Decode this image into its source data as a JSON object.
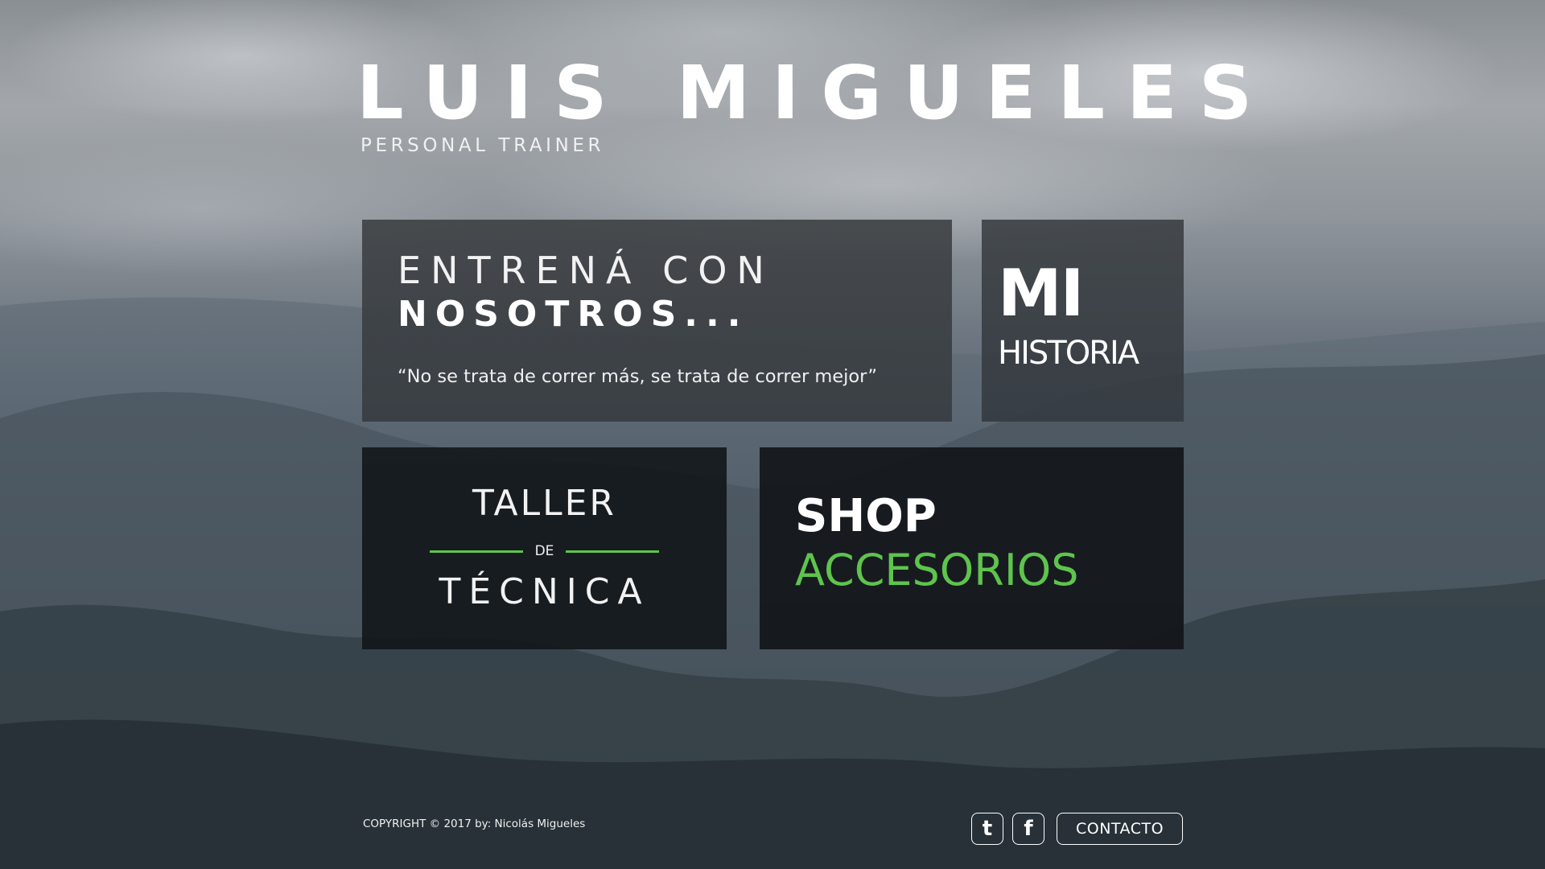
{
  "header": {
    "title": "LUIS MIGUELES",
    "subtitle": "PERSONAL TRAINER"
  },
  "tiles": {
    "entrena": {
      "line1": "ENTRENÁ CON",
      "line2": "NOSOTROS...",
      "quote": "“No se trata de correr más, se trata de correr mejor”"
    },
    "historia": {
      "line1": "MI",
      "line2": "HISTORIA"
    },
    "taller": {
      "line1": "TALLER",
      "connector": "DE",
      "line2": "TÉCNICA"
    },
    "shop": {
      "line1": "SHOP",
      "line2": "ACCESORIOS"
    }
  },
  "footer": {
    "copyright": "COPYRIGHT © 2017 by: Nicolás Migueles",
    "social": [
      {
        "icon": "tumblr-icon",
        "glyph": "t"
      },
      {
        "icon": "facebook-icon",
        "glyph": "f"
      }
    ],
    "contact_label": "CONTACTO"
  },
  "colors": {
    "accent": "#5ec44d",
    "text": "#ffffff"
  }
}
